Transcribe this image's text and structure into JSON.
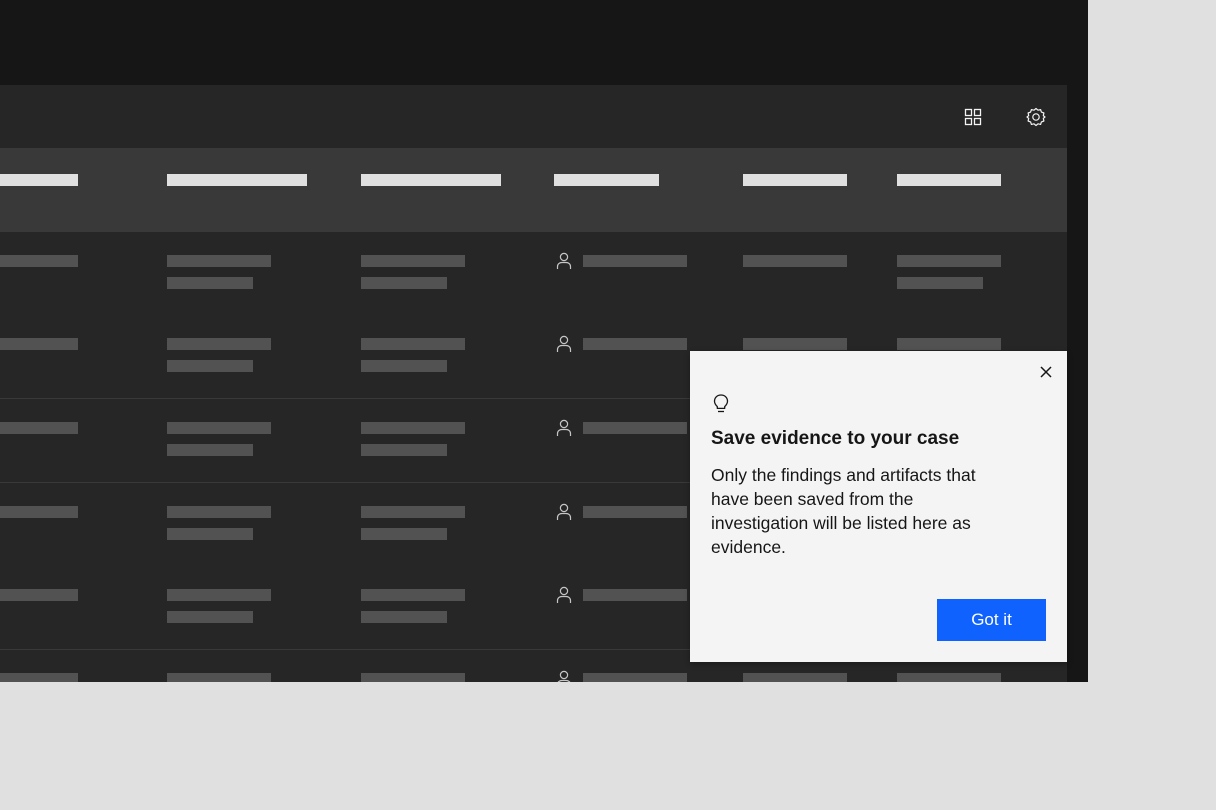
{
  "toolbar": {
    "icons": [
      "grid-icon",
      "settings-icon"
    ]
  },
  "table": {
    "row_icon": "user-icon"
  },
  "popover": {
    "icon": "lightbulb-icon",
    "close_icon": "close-icon",
    "title": "Save evidence to your case",
    "body": "Only the findings and artifacts that have been saved from the investigation will be listed here as evidence.",
    "button_label": "Got it"
  },
  "colors": {
    "page_bg": "#e0e0e0",
    "app_bg": "#161616",
    "panel_bg": "#262626",
    "header_bg": "#393939",
    "popover_bg": "#f4f4f4",
    "primary_button": "#0f62fe"
  }
}
